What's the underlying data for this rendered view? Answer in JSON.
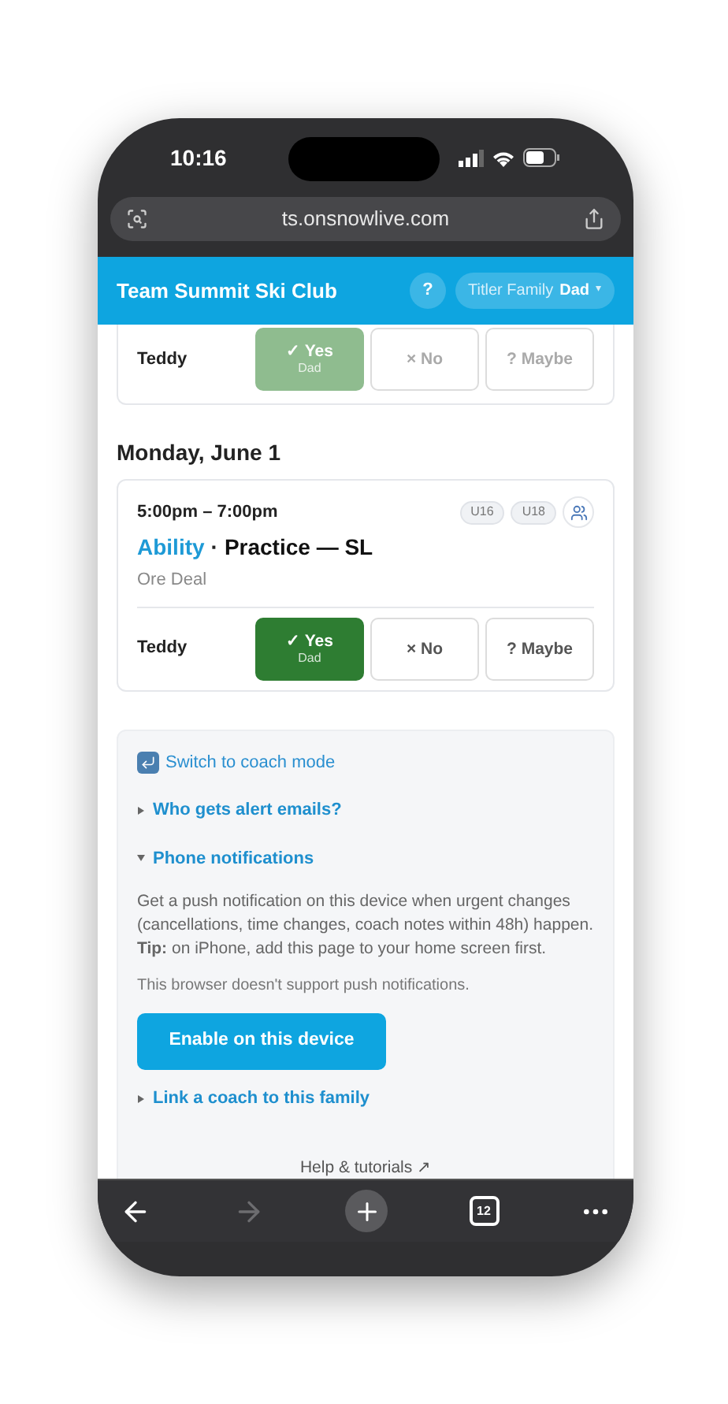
{
  "status_bar": {
    "time": "10:16"
  },
  "browser": {
    "url": "ts.onsnowlive.com"
  },
  "header": {
    "title": "Team Summit Ski Club",
    "help": "?",
    "family": "Titler Family",
    "role": "Dad",
    "caret": "▾"
  },
  "events": [
    {
      "dimmed": true,
      "rsvps": [
        {
          "name": "Teddy",
          "options": [
            {
              "kind": "yes",
              "icon": "✓",
              "label": "Yes",
              "by": "Dad",
              "selected": true
            },
            {
              "kind": "no",
              "icon": "×",
              "label": "No",
              "selected": false
            },
            {
              "kind": "maybe",
              "icon": "?",
              "label": "Maybe",
              "selected": false
            }
          ]
        }
      ]
    },
    {
      "dimmed": false,
      "day": "Monday, June 1",
      "time": "5:00pm – 7:00pm",
      "tags": [
        "U16",
        "U18"
      ],
      "category": "Ability",
      "separator": "·",
      "title": "Practice — SL",
      "location": "Ore Deal",
      "rsvps": [
        {
          "name": "Teddy",
          "options": [
            {
              "kind": "yes",
              "icon": "✓",
              "label": "Yes",
              "by": "Dad",
              "selected": true
            },
            {
              "kind": "no",
              "icon": "×",
              "label": "No",
              "selected": false
            },
            {
              "kind": "maybe",
              "icon": "?",
              "label": "Maybe",
              "selected": false
            }
          ]
        }
      ]
    }
  ],
  "panel": {
    "switch_link": "Switch to coach mode",
    "sections": [
      {
        "title": "Who gets alert emails?",
        "expanded": false
      },
      {
        "title": "Phone notifications",
        "expanded": true,
        "body": "Get a push notification on this device when urgent changes (cancellations, time changes, coach notes within 48h) happen. **Tip:** on iPhone, add this page to your home screen first.",
        "note": "This browser doesn't support push notifications.",
        "button": "Enable on this device"
      },
      {
        "title": "Link a coach to this family",
        "expanded": false
      }
    ],
    "help": "Help & tutorials ↗"
  },
  "toolbar": [
    {
      "kind": "back",
      "disabled": false
    },
    {
      "kind": "forward",
      "disabled": true
    },
    {
      "kind": "new-tab",
      "disabled": false
    },
    {
      "kind": "tabs",
      "count": "12",
      "disabled": false
    },
    {
      "kind": "more",
      "disabled": false
    }
  ]
}
